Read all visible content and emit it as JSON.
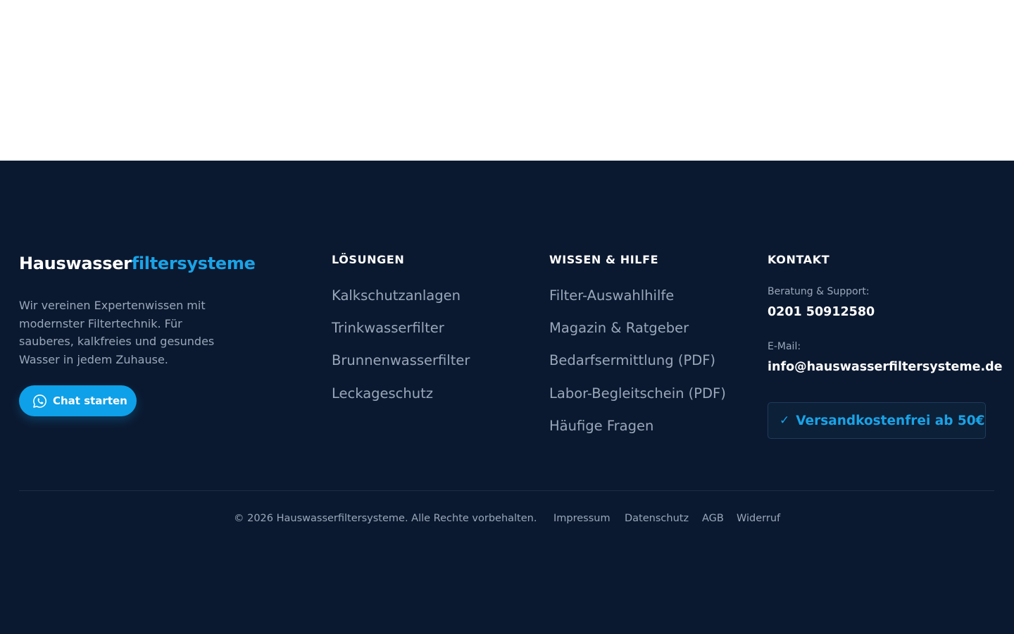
{
  "brand": {
    "part1": "Hauswasser",
    "part2": "filtersysteme"
  },
  "tagline": "Wir vereinen Expertenwissen mit modernster Filtertechnik. Für sauberes, kalkfreies und gesundes Wasser in jedem Zuhause.",
  "chat_button": {
    "label": "Chat starten",
    "icon": "whatsapp-icon"
  },
  "columns": [
    {
      "title": "LÖSUNGEN",
      "links": [
        "Kalkschutzanlagen",
        "Trinkwasserfilter",
        "Brunnenwasserfilter",
        "Leckageschutz"
      ]
    },
    {
      "title": "WISSEN & HILFE",
      "links": [
        "Filter-Auswahlhilfe",
        "Magazin & Ratgeber",
        "Bedarfsermittlung (PDF)",
        "Labor-Begleitschein (PDF)",
        "Häufige Fragen"
      ]
    }
  ],
  "contact": {
    "title": "KONTAKT",
    "support_label": "Beratung & Support:",
    "phone": "0201 50912580",
    "email_label": "E-Mail:",
    "email": "info@hauswasserfiltersysteme.de",
    "shipping_check": "✓",
    "shipping_text": "Versandkostenfrei ab 50€"
  },
  "bottom": {
    "copyright": "© 2026 Hauswasserfiltersysteme. Alle Rechte vorbehalten.",
    "links": [
      "Impressum",
      "Datenschutz",
      "AGB",
      "Widerruf"
    ]
  },
  "colors": {
    "background": "#0b1930",
    "accent": "#1aa3e6",
    "muted_text": "#9aa7ba"
  }
}
